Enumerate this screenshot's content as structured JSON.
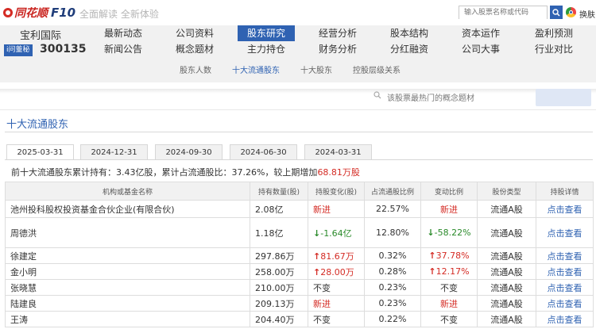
{
  "topbar": {
    "logo_text": "同花顺",
    "logo_f10": "F10",
    "slogan": "全面解读 全新体验",
    "search_placeholder": "输入股票名称或代码",
    "switch_label": "换肤"
  },
  "stock": {
    "name": "宝利国际",
    "tag": "i问董秘",
    "code": "300135"
  },
  "nav": [
    {
      "top": "最新动态",
      "bottom": "新闻公告",
      "active": false
    },
    {
      "top": "公司资料",
      "bottom": "概念题材",
      "active": false
    },
    {
      "top": "股东研究",
      "bottom": "主力持仓",
      "active": true
    },
    {
      "top": "经营分析",
      "bottom": "财务分析",
      "active": false
    },
    {
      "top": "股本结构",
      "bottom": "分红融资",
      "active": false
    },
    {
      "top": "资本运作",
      "bottom": "公司大事",
      "active": false
    },
    {
      "top": "盈利预测",
      "bottom": "行业对比",
      "active": false
    }
  ],
  "subnav": [
    {
      "label": "股东人数",
      "active": false
    },
    {
      "label": "十大流通股东",
      "active": true
    },
    {
      "label": "十大股东",
      "active": false
    },
    {
      "label": "控股层级关系",
      "active": false
    }
  ],
  "concept": {
    "placeholder": "该股票最热门的概念题材"
  },
  "section_title": "十大流通股东",
  "tabs": [
    "2025-03-31",
    "2024-12-31",
    "2024-09-30",
    "2024-06-30",
    "2024-03-31"
  ],
  "summary": {
    "prefix": "前十大流通股东累计持有：3.43亿股，累计占流通股比：37.26%，较上期增加",
    "change": "68.81万股"
  },
  "table": {
    "headers": [
      "机构或基金名称",
      "持有数量(股)",
      "持股变化(股)",
      "占流通股比例",
      "变动比例",
      "股份类型",
      "持股详情"
    ],
    "rows": [
      {
        "name": "池州投科股权投资基金合伙企业(有限合伙)",
        "qty": "2.08亿",
        "change": "新进",
        "change_dir": "new",
        "ratio": "22.57%",
        "pct": "新进",
        "pct_dir": "new",
        "type": "流通A股",
        "detail": "点击查看"
      },
      {
        "name": "周德洪",
        "qty": "1.18亿",
        "change": "-1.64亿",
        "change_dir": "down",
        "ratio": "12.80%",
        "pct": "-58.22%",
        "pct_dir": "down",
        "type": "流通A股",
        "detail": "点击查看"
      },
      {
        "name": "徐建定",
        "qty": "297.86万",
        "change": "81.67万",
        "change_dir": "up",
        "ratio": "0.32%",
        "pct": "37.78%",
        "pct_dir": "up",
        "type": "流通A股",
        "detail": "点击查看"
      },
      {
        "name": "金小明",
        "qty": "258.00万",
        "change": "28.00万",
        "change_dir": "up",
        "ratio": "0.28%",
        "pct": "12.17%",
        "pct_dir": "up",
        "type": "流通A股",
        "detail": "点击查看"
      },
      {
        "name": "张晓慧",
        "qty": "210.00万",
        "change": "不变",
        "change_dir": "same",
        "ratio": "0.23%",
        "pct": "不变",
        "pct_dir": "same",
        "type": "流通A股",
        "detail": "点击查看"
      },
      {
        "name": "陆建良",
        "qty": "209.13万",
        "change": "新进",
        "change_dir": "new",
        "ratio": "0.23%",
        "pct": "新进",
        "pct_dir": "new",
        "type": "流通A股",
        "detail": "点击查看"
      },
      {
        "name": "王涛",
        "qty": "204.40万",
        "change": "不变",
        "change_dir": "same",
        "ratio": "0.22%",
        "pct": "不变",
        "pct_dir": "same",
        "type": "流通A股",
        "detail": "点击查看"
      }
    ]
  }
}
